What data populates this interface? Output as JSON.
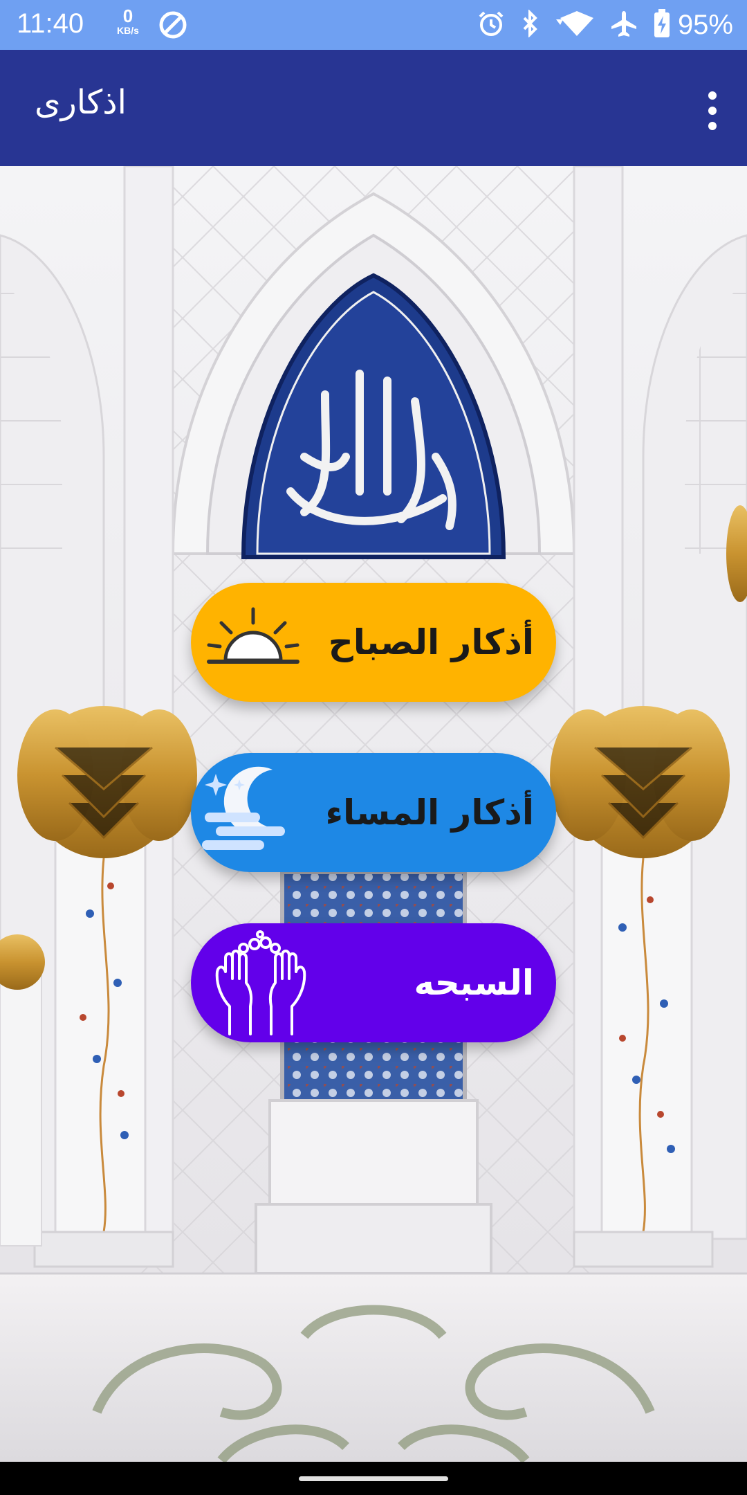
{
  "status_bar": {
    "time": "11:40",
    "net_speed_value": "0",
    "net_speed_unit": "KB/s",
    "battery_percent": "95%",
    "icons": [
      "data-saver-icon",
      "alarm-icon",
      "bluetooth-icon",
      "wifi-icon",
      "airplane-icon",
      "battery-charging-icon"
    ]
  },
  "app_bar": {
    "title": "اذكارى",
    "menu_icon": "overflow-menu-icon"
  },
  "buttons": {
    "morning": {
      "label": "أذكار الصباح",
      "icon": "sunrise-icon",
      "color": "#ffb300"
    },
    "evening": {
      "label": "أذكار المساء",
      "icon": "moon-night-icon",
      "color": "#1e88e5"
    },
    "tasbih": {
      "label": "السبحه",
      "icon": "prayer-hands-beads-icon",
      "color": "#6200ea"
    }
  },
  "colors": {
    "status_bar": "#6fa0f2",
    "app_bar": "#283593",
    "nav_bar": "#000000"
  }
}
